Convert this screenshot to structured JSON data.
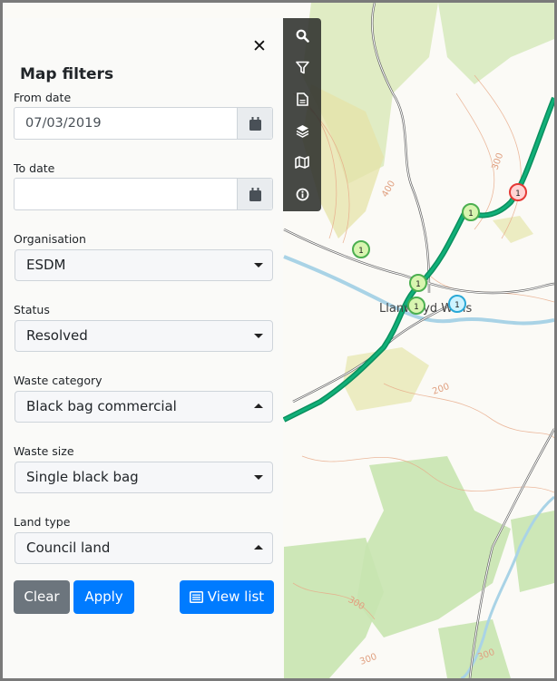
{
  "panel": {
    "title": "Map filters",
    "close_icon": "close-icon",
    "from_date": {
      "label": "From date",
      "value": "07/03/2019",
      "icon": "calendar-icon"
    },
    "to_date": {
      "label": "To date",
      "value": "",
      "icon": "calendar-icon"
    },
    "organisation": {
      "label": "Organisation",
      "value": "ESDM",
      "caret": "down"
    },
    "status": {
      "label": "Status",
      "value": "Resolved",
      "caret": "down"
    },
    "waste_category": {
      "label": "Waste category",
      "value": "Black bag commercial",
      "caret": "up"
    },
    "waste_size": {
      "label": "Waste size",
      "value": "Single black bag",
      "caret": "down"
    },
    "land_type": {
      "label": "Land type",
      "value": "Council land",
      "caret": "up"
    },
    "buttons": {
      "clear": "Clear",
      "apply": "Apply",
      "view_list": "View list"
    }
  },
  "toolbar": {
    "items": [
      "search-icon",
      "filter-icon",
      "document-icon",
      "layers-icon",
      "map-icon",
      "info-icon"
    ]
  },
  "map": {
    "place_label": "Llanwrtyd Wells",
    "contour_labels": [
      "400",
      "300",
      "200",
      "300",
      "300",
      "300"
    ],
    "markers": [
      {
        "count": "1",
        "color": "#4caf50",
        "fill": "#d8f5b0",
        "status": "green"
      },
      {
        "count": "1",
        "color": "#4caf50",
        "fill": "#d8f5b0",
        "status": "green"
      },
      {
        "count": "1",
        "color": "#4caf50",
        "fill": "#d8f5b0",
        "status": "green"
      },
      {
        "count": "1",
        "color": "#4caf50",
        "fill": "#d8f5b0",
        "status": "green"
      },
      {
        "count": "1",
        "color": "#e53935",
        "fill": "#ffd4d4",
        "status": "red"
      },
      {
        "count": "1",
        "color": "#29a8d6",
        "fill": "#cdf3ff",
        "status": "blue"
      }
    ]
  },
  "colors": {
    "primary": "#007bff",
    "secondary": "#6c757d",
    "route": "#0aa36a"
  }
}
